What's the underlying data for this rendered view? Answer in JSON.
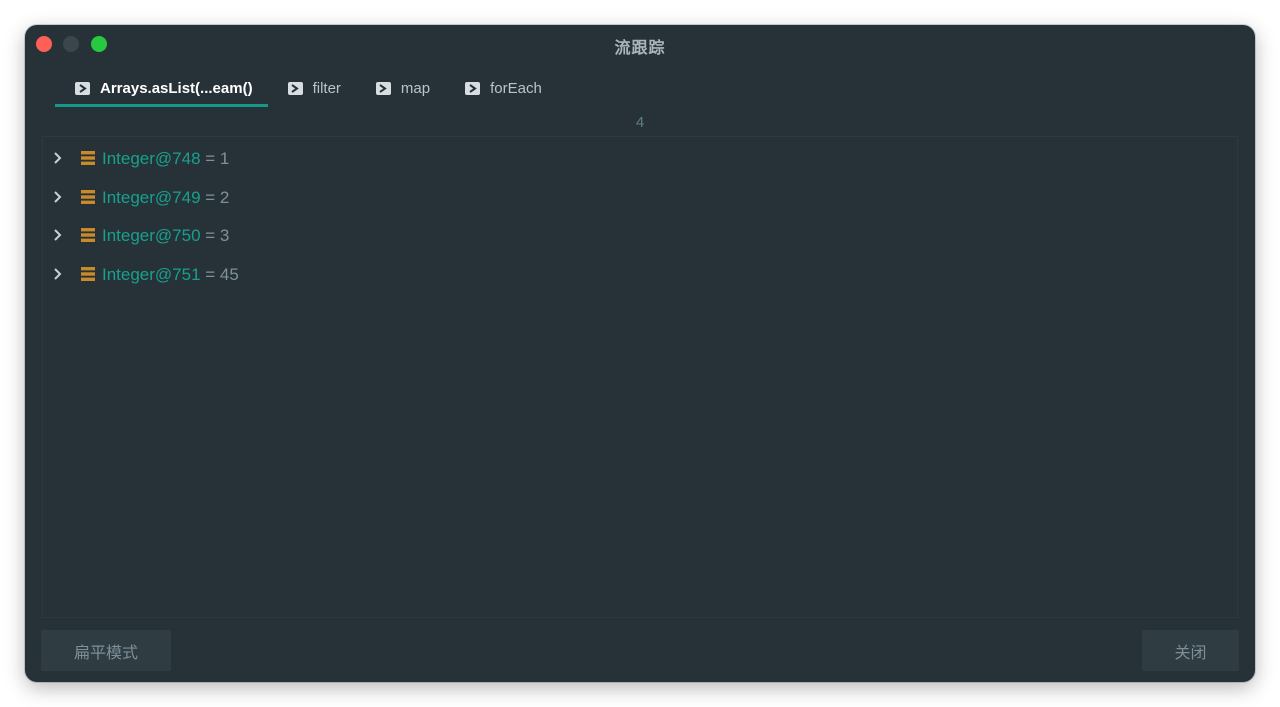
{
  "window": {
    "title": "流跟踪"
  },
  "tabs": [
    {
      "label": "Arrays.asList(...eam()",
      "active": true
    },
    {
      "label": "filter",
      "active": false
    },
    {
      "label": "map",
      "active": false
    },
    {
      "label": "forEach",
      "active": false
    }
  ],
  "count": "4",
  "rows": [
    {
      "name": "Integer@748",
      "value": "= 1"
    },
    {
      "name": "Integer@749",
      "value": "= 2"
    },
    {
      "name": "Integer@750",
      "value": "= 3"
    },
    {
      "name": "Integer@751",
      "value": "= 45"
    }
  ],
  "buttons": {
    "flat_mode": "扁平模式",
    "close": "关闭"
  },
  "colors": {
    "background": "#263238",
    "accent": "#19988a",
    "variable_name": "#18a08e",
    "field_icon": "#c98a2b"
  },
  "icons": {
    "tab": "terminal-icon",
    "expand": "chevron-right-icon",
    "field": "field-icon"
  }
}
